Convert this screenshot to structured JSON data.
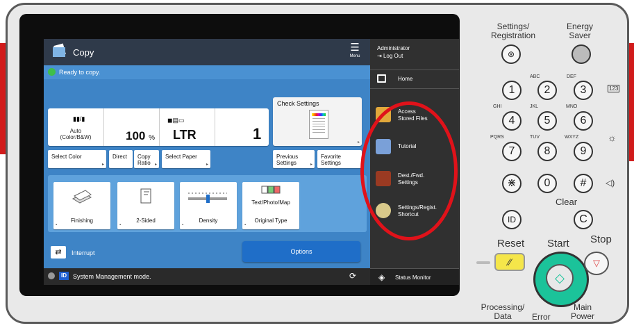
{
  "app": {
    "title": "Copy",
    "menu_label": "Menu"
  },
  "status": {
    "message": "Ready to copy."
  },
  "summary": {
    "color_mode_line1": "Auto",
    "color_mode_line2": "(Color/B&W)",
    "ratio_value": "100",
    "ratio_unit": "%",
    "paper": "LTR",
    "copies": "1"
  },
  "check_settings": {
    "label": "Check Settings"
  },
  "buttons": {
    "select_color": "Select Color",
    "direct": "Direct",
    "copy_ratio_line1": "Copy",
    "copy_ratio_line2": "Ratio",
    "select_paper": "Select Paper",
    "previous_settings_line1": "Previous",
    "previous_settings_line2": "Settings",
    "favorite_settings_line1": "Favorite",
    "favorite_settings_line2": "Settings"
  },
  "functions": [
    {
      "label": "Finishing"
    },
    {
      "label": "2-Sided"
    },
    {
      "label": "Density"
    },
    {
      "label": "Original Type",
      "sub": "Text/Photo/Map"
    }
  ],
  "interrupt": {
    "label": "Interrupt"
  },
  "options": {
    "label": "Options"
  },
  "system_bar": {
    "id_badge": "ID",
    "message": "System Management mode."
  },
  "side": {
    "user": "Administrator",
    "logout": "Log Out",
    "home": "Home",
    "items": [
      {
        "line1": "Access",
        "line2": "Stored Files"
      },
      {
        "line1": "Tutorial",
        "line2": ""
      },
      {
        "line1": "Dest./Fwd.",
        "line2": "Settings"
      },
      {
        "line1": "Settings/Regist.",
        "line2": "Shortcut"
      }
    ],
    "status_monitor": "Status Monitor"
  },
  "keypad": {
    "settings_registration_line1": "Settings/",
    "settings_registration_line2": "Registration",
    "energy_saver_line1": "Energy",
    "energy_saver_line2": "Saver",
    "keys": [
      "1",
      "2",
      "3",
      "4",
      "5",
      "6",
      "7",
      "8",
      "9",
      "⋇",
      "0",
      "#"
    ],
    "letters": [
      "ABC",
      "DEF",
      "GHI",
      "JKL",
      "MNO",
      "PQRS",
      "TUV",
      "WXYZ"
    ],
    "clear": "Clear",
    "clear_key": "C",
    "id_key": "ID",
    "reset": "Reset",
    "start": "Start",
    "stop": "Stop",
    "processing_data_line1": "Processing/",
    "processing_data_line2": "Data",
    "error": "Error",
    "main_power_line1": "Main",
    "main_power_line2": "Power",
    "counter_badge": "123"
  },
  "colors": {
    "accent": "#3e84c6",
    "start": "#1bc39a",
    "highlight": "#e0121a"
  }
}
